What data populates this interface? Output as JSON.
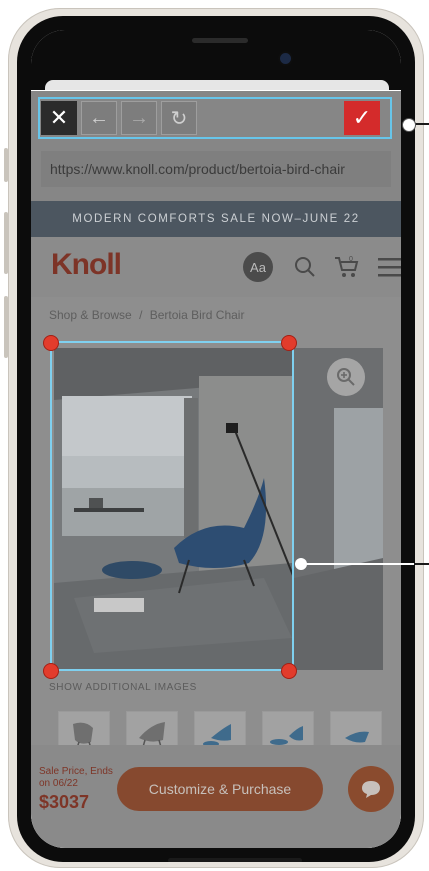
{
  "toolbar": {
    "close_glyph": "✕",
    "back_glyph": "←",
    "forward_glyph": "→",
    "reload_glyph": "↻",
    "confirm_glyph": "✓"
  },
  "browser": {
    "url": "https://www.knoll.com/product/bertoia-bird-chair"
  },
  "promo": {
    "text": "MODERN COMFORTS SALE NOW–JUNE 22"
  },
  "header": {
    "logo_text": "Knoll",
    "text_size_label": "Aa",
    "cart_count": "0"
  },
  "breadcrumb": {
    "items": [
      "Shop & Browse",
      "/",
      "Bertoia Bird Chair"
    ]
  },
  "product": {
    "show_images_label": "SHOW ADDITIONAL IMAGES"
  },
  "purchase": {
    "sale_label": "Sale Price, Ends on 06/22",
    "price": "$3037",
    "customize_label": "Customize & Purchase"
  },
  "colors": {
    "accent_red": "#d42b2b",
    "selection_blue": "#67c5ea",
    "brand": "#7d3427"
  }
}
